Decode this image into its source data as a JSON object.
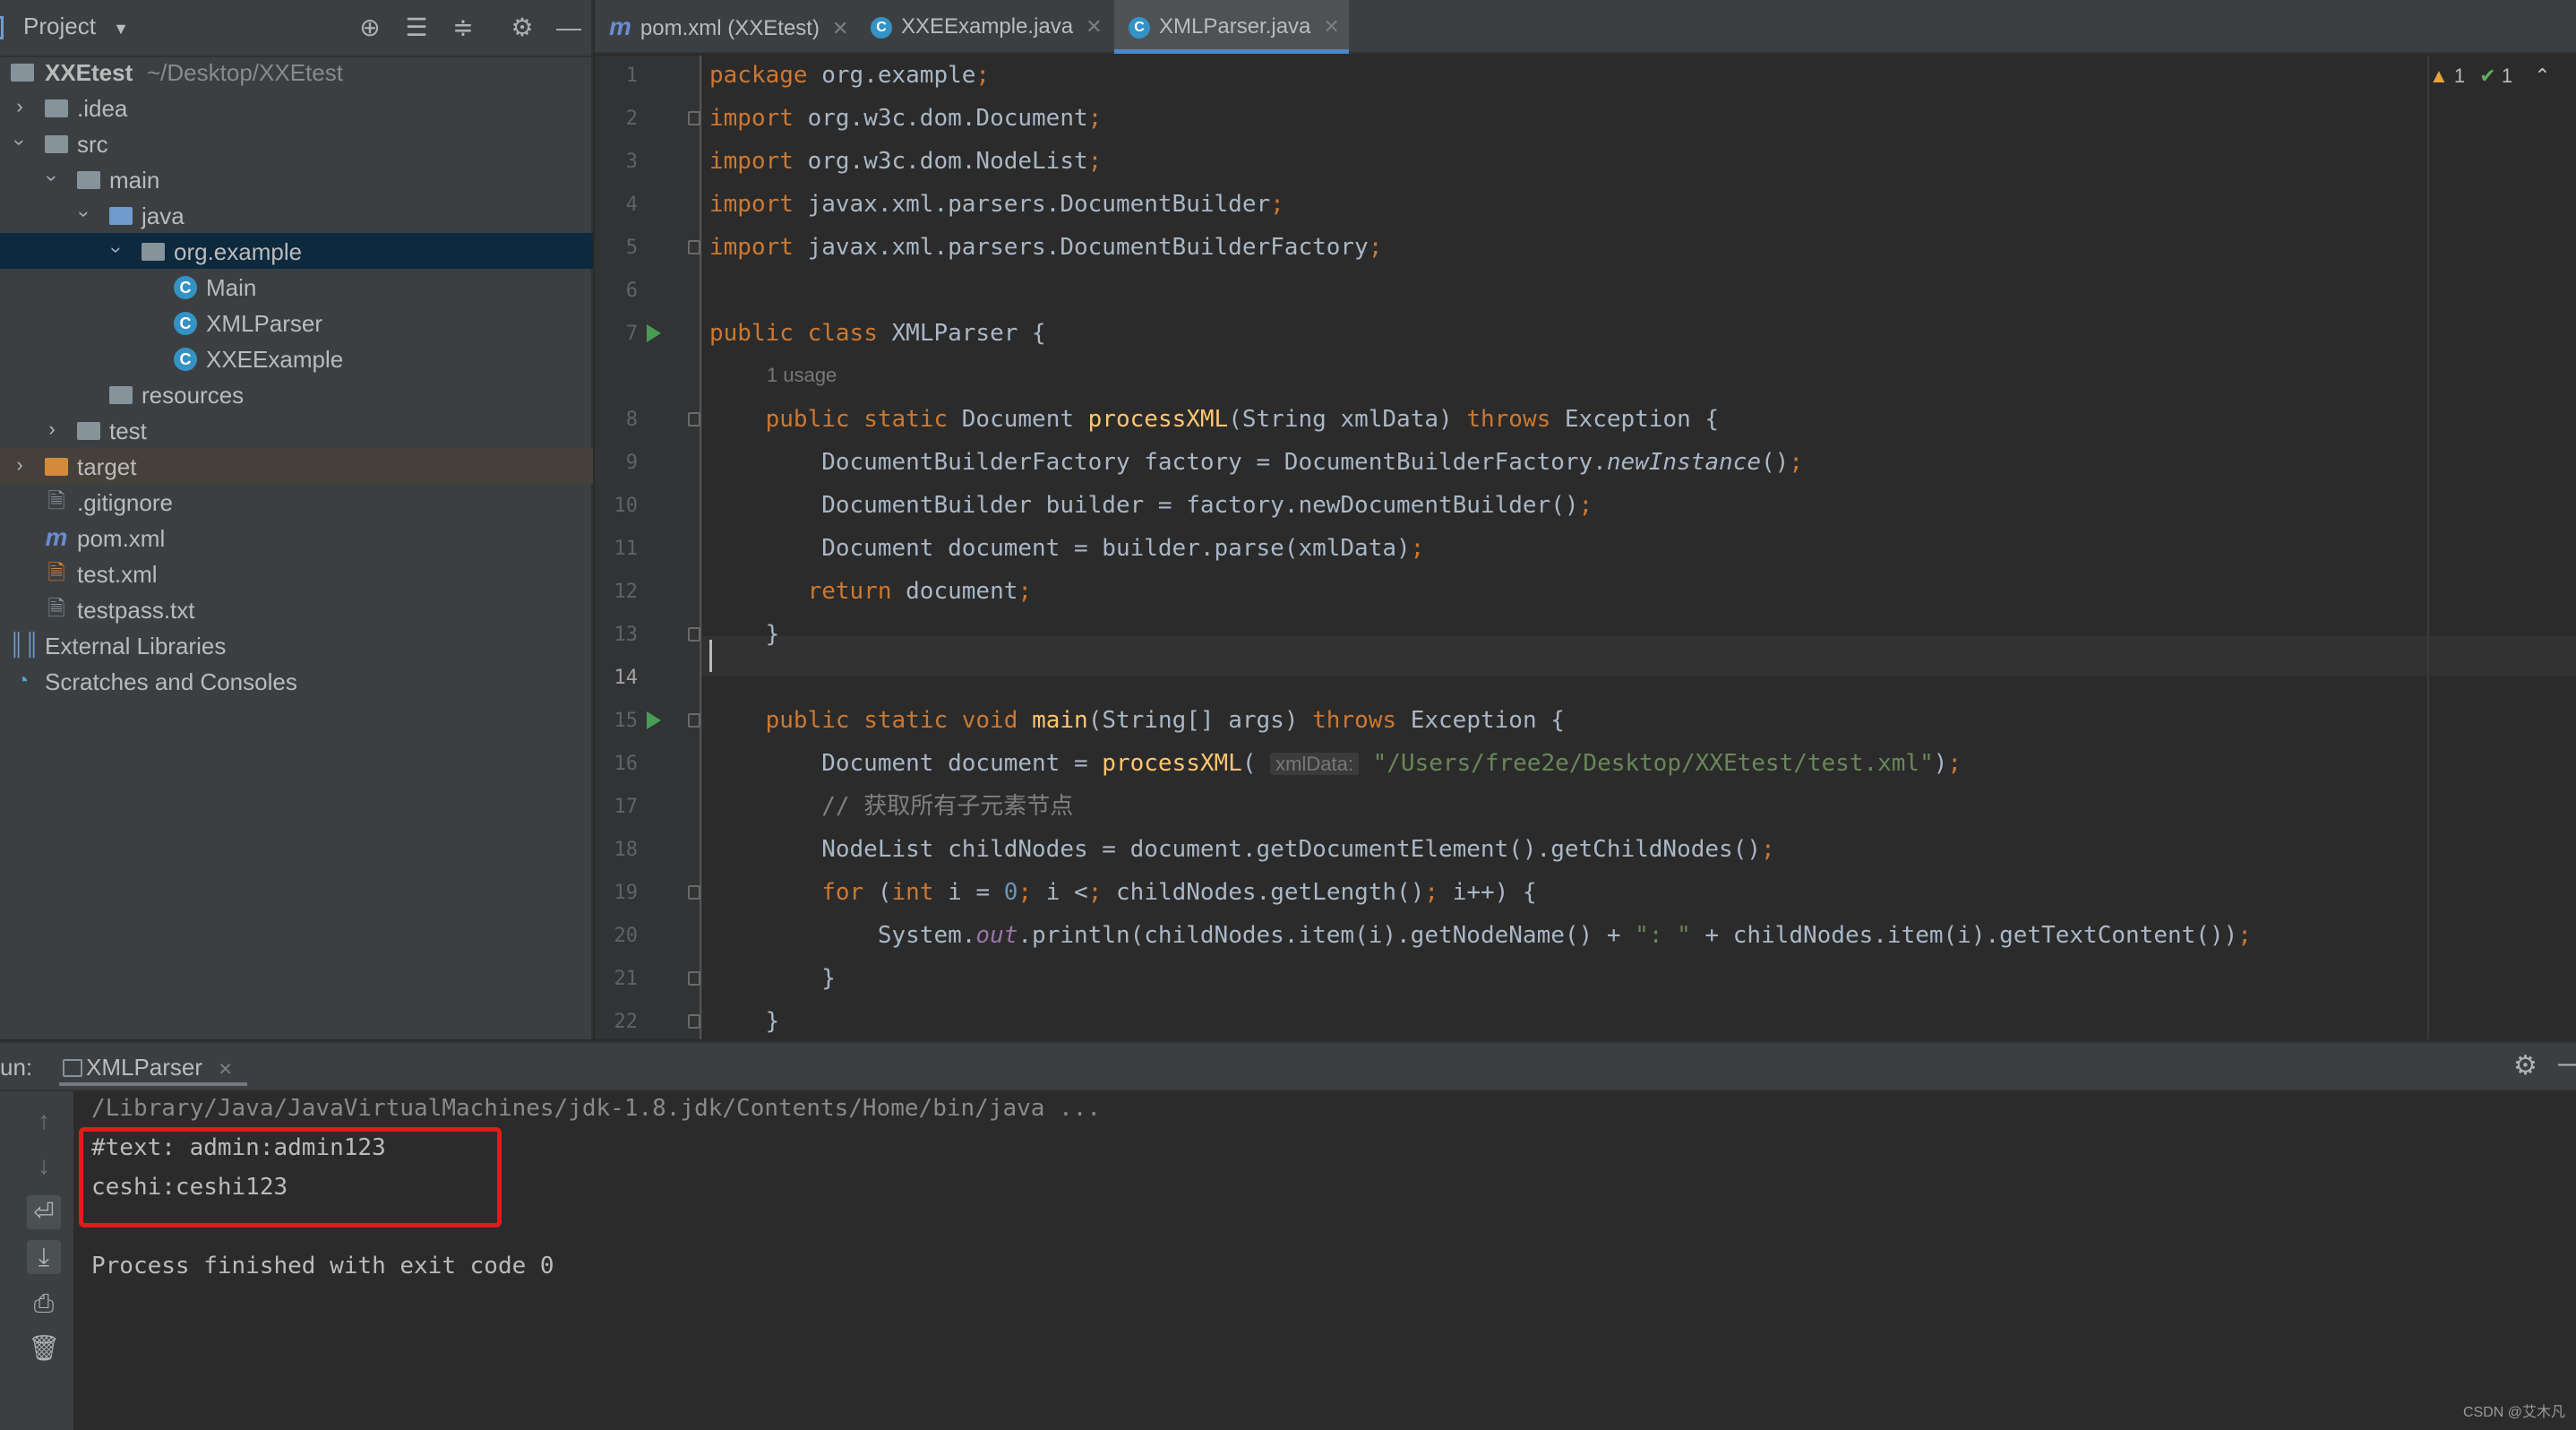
{
  "project_panel": {
    "title": "Project",
    "tree": [
      {
        "label": "XXEtest",
        "hint": "~/Desktop/XXEtest",
        "icon": "module",
        "expanded": true
      },
      {
        "label": ".idea",
        "icon": "folder",
        "expanded": false
      },
      {
        "label": "src",
        "icon": "folder",
        "expanded": true
      },
      {
        "label": "main",
        "icon": "folder",
        "expanded": true
      },
      {
        "label": "java",
        "icon": "source-folder",
        "expanded": true
      },
      {
        "label": "org.example",
        "icon": "package",
        "expanded": true,
        "selected": true
      },
      {
        "label": "Main",
        "icon": "java-class"
      },
      {
        "label": "XMLParser",
        "icon": "java-class"
      },
      {
        "label": "XXEExample",
        "icon": "java-class"
      },
      {
        "label": "resources",
        "icon": "resources-folder"
      },
      {
        "label": "test",
        "icon": "folder",
        "expanded": false
      },
      {
        "label": "target",
        "icon": "excluded-folder",
        "expanded": false
      },
      {
        "label": ".gitignore",
        "icon": "gitignore-file"
      },
      {
        "label": "pom.xml",
        "icon": "maven-file"
      },
      {
        "label": "test.xml",
        "icon": "xml-file"
      },
      {
        "label": "testpass.txt",
        "icon": "text-file"
      },
      {
        "label": "External Libraries",
        "icon": "libraries"
      },
      {
        "label": "Scratches and Consoles",
        "icon": "scratches"
      }
    ]
  },
  "tabs": [
    {
      "label": "pom.xml (XXEtest)",
      "icon": "maven-icon",
      "active": false
    },
    {
      "label": "XXEExample.java",
      "icon": "java-class-icon",
      "active": false
    },
    {
      "label": "XMLParser.java",
      "icon": "java-class-icon",
      "active": true
    }
  ],
  "inspections": {
    "warnings": "1",
    "typos": "1"
  },
  "editor": {
    "current_line": 14,
    "lines": [
      "package org.example;",
      "import org.w3c.dom.Document;",
      "import org.w3c.dom.NodeList;",
      "import javax.xml.parsers.DocumentBuilder;",
      "import javax.xml.parsers.DocumentBuilderFactory;",
      "",
      "public class XMLParser {",
      "    public static Document processXML(String xmlData) throws Exception {",
      "        DocumentBuilderFactory factory = DocumentBuilderFactory.newInstance();",
      "        DocumentBuilder builder = factory.newDocumentBuilder();",
      "        Document document = builder.parse(xmlData);",
      "       return document;",
      "    }",
      "",
      "    public static void main(String[] args) throws Exception {",
      "        Document document = processXML( xmlData: \"/Users/free2e/Desktop/XXEtest/test.xml\");",
      "        // 获取所有子元素节点",
      "        NodeList childNodes = document.getDocumentElement().getChildNodes();",
      "        for (int i = 0; i < childNodes.getLength(); i++) {",
      "            System.out.println(childNodes.item(i).getNodeName() + \": \" + childNodes.item(i).getTextContent());",
      "        }",
      "    }",
      "}",
      ""
    ],
    "usage_hint": "1 usage",
    "param_hint": "xmlData:"
  },
  "run_panel": {
    "label": "un:",
    "tab": "XMLParser",
    "output": [
      "/Library/Java/JavaVirtualMachines/jdk-1.8.jdk/Contents/Home/bin/java ...",
      "#text: admin:admin123",
      "ceshi:ceshi123",
      "",
      "Process finished with exit code 0"
    ]
  },
  "watermark": "CSDN @艾木凡",
  "colors": {
    "keyword": "#cc7832",
    "method": "#ffc66d",
    "string": "#6a8759",
    "comment": "#808080",
    "selection": "#0d293e",
    "highlight_box": "#e11b1b"
  }
}
